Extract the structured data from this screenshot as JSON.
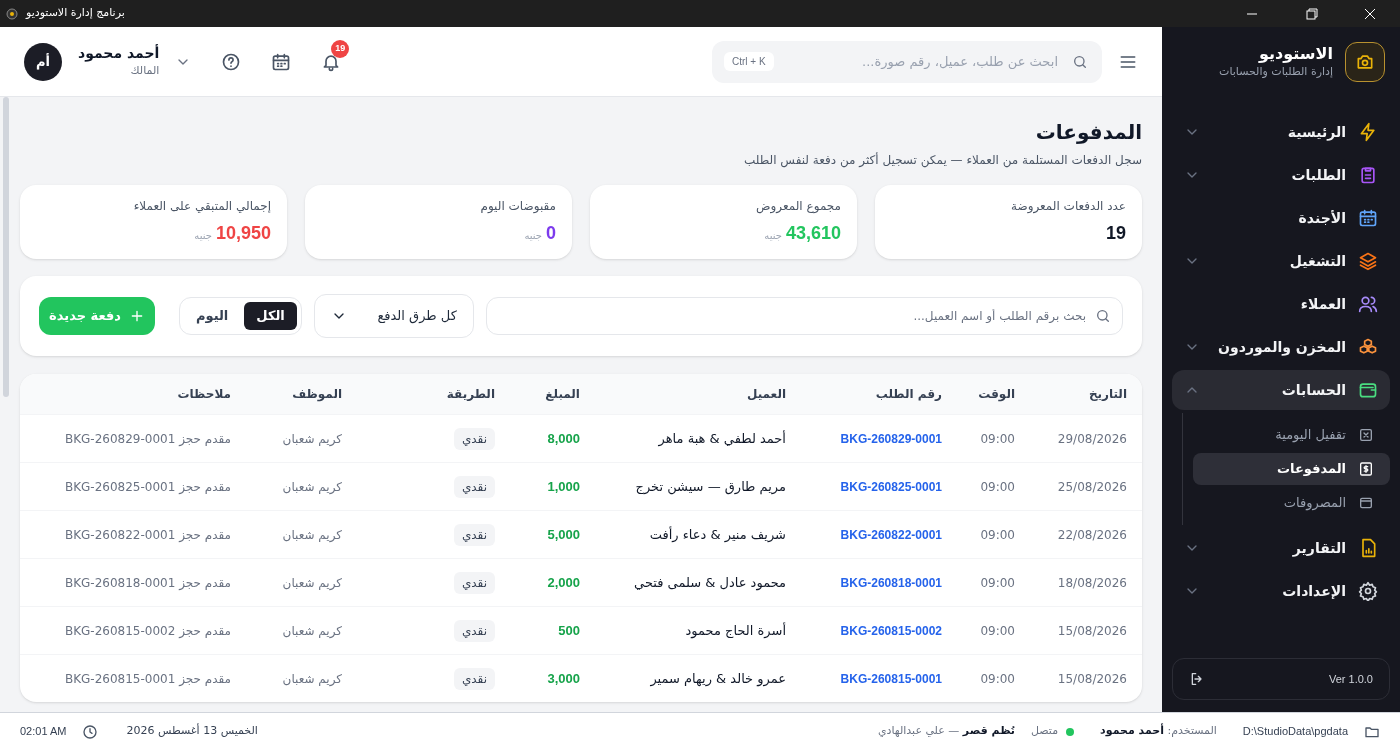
{
  "window": {
    "title": "برنامج إدارة الاستوديو"
  },
  "sidebar": {
    "brand": "الاستوديو",
    "tagline": "إدارة الطلبات والحسابات",
    "items": [
      {
        "kind": "group",
        "label": "الرئيسية",
        "color": "#eab308",
        "expanded": false,
        "selected": false
      },
      {
        "kind": "group",
        "label": "الطلبات",
        "color": "#a855f7",
        "expanded": false,
        "selected": false
      },
      {
        "kind": "link",
        "label": "الأجندة",
        "color": "#60a5fa",
        "selected": false
      },
      {
        "kind": "group",
        "label": "التشغيل",
        "color": "#f97316",
        "expanded": false,
        "selected": false
      },
      {
        "kind": "link",
        "label": "العملاء",
        "color": "#a78bfa",
        "selected": false
      },
      {
        "kind": "group",
        "label": "المخزن والموردون",
        "color": "#fb923c",
        "expanded": false,
        "selected": false
      },
      {
        "kind": "group",
        "label": "الحسابات",
        "color": "#4ade80",
        "expanded": true,
        "selected": true,
        "children": [
          {
            "label": "تقفيل اليومية",
            "selected": false
          },
          {
            "label": "المدفوعات",
            "selected": true
          },
          {
            "label": "المصروفات",
            "selected": false
          }
        ]
      },
      {
        "kind": "group",
        "label": "التقارير",
        "color": "#eab308",
        "expanded": false,
        "selected": false
      },
      {
        "kind": "group",
        "label": "الإعدادات",
        "color": "#d1d5db",
        "expanded": false,
        "selected": false
      }
    ],
    "version": "Ver 1.0.0"
  },
  "header": {
    "search_placeholder": "ابحث عن طلب، عميل، رقم صورة...",
    "shortcut": "Ctrl + K",
    "notifications": "19",
    "user_name": "أحمد محمود",
    "user_role": "المالك",
    "avatar": "أم"
  },
  "page": {
    "title": "المدفوعات",
    "subtitle": "سجل الدفعات المستلمة من العملاء — يمكن تسجيل أكثر من دفعة لنفس الطلب"
  },
  "stats": [
    {
      "label": "عدد الدفعات المعروضة",
      "value": "19",
      "color": "#111827"
    },
    {
      "label": "مجموع المعروض",
      "value": "43,610",
      "unit": "جنيه",
      "color": "#22c55e"
    },
    {
      "label": "مقبوضات اليوم",
      "value": "0",
      "unit": "جنيه",
      "color": "#7c3aed"
    },
    {
      "label": "إجمالي المتبقي على العملاء",
      "value": "10,950",
      "unit": "جنيه",
      "color": "#ef4444"
    }
  ],
  "filters": {
    "search_placeholder": "بحث برقم الطلب أو اسم العميل...",
    "method": "كل طرق الدفع",
    "periods": [
      {
        "label": "الكل",
        "selected": true
      },
      {
        "label": "اليوم",
        "selected": false
      }
    ],
    "new_button": "دفعة جديدة"
  },
  "table": {
    "columns": [
      "التاريخ",
      "الوقت",
      "رقم الطلب",
      "العميل",
      "المبلغ",
      "الطريقة",
      "الموظف",
      "ملاحظات"
    ],
    "rows": [
      [
        "29/08/2026",
        "09:00",
        "BKG-260829-0001",
        "أحمد لطفي & هبة ماهر",
        "8,000",
        "نقدي",
        "كريم شعبان",
        "مقدم حجز BKG-260829-0001"
      ],
      [
        "25/08/2026",
        "09:00",
        "BKG-260825-0001",
        "مريم طارق — سيشن تخرج",
        "1,000",
        "نقدي",
        "كريم شعبان",
        "مقدم حجز BKG-260825-0001"
      ],
      [
        "22/08/2026",
        "09:00",
        "BKG-260822-0001",
        "شريف منير & دعاء رأفت",
        "5,000",
        "نقدي",
        "كريم شعبان",
        "مقدم حجز BKG-260822-0001"
      ],
      [
        "18/08/2026",
        "09:00",
        "BKG-260818-0001",
        "محمود عادل & سلمى فتحي",
        "2,000",
        "نقدي",
        "كريم شعبان",
        "مقدم حجز BKG-260818-0001"
      ],
      [
        "15/08/2026",
        "09:00",
        "BKG-260815-0002",
        "أسرة الحاج محمود",
        "500",
        "نقدي",
        "كريم شعبان",
        "مقدم حجز BKG-260815-0002"
      ],
      [
        "15/08/2026",
        "09:00",
        "BKG-260815-0001",
        "عمرو خالد & ريهام سمير",
        "3,000",
        "نقدي",
        "كريم شعبان",
        "مقدم حجز BKG-260815-0001"
      ]
    ]
  },
  "status_bar": {
    "path": "D:\\StudioData\\pgdata",
    "user": "المستخدم: **أحمد محمود**",
    "connected": true,
    "connection": "متصل",
    "system": "**نُظم قصر** — علي عبدالهادي",
    "date": "الخميس 13 أغسطس 2026",
    "time": "02:01 AM"
  }
}
